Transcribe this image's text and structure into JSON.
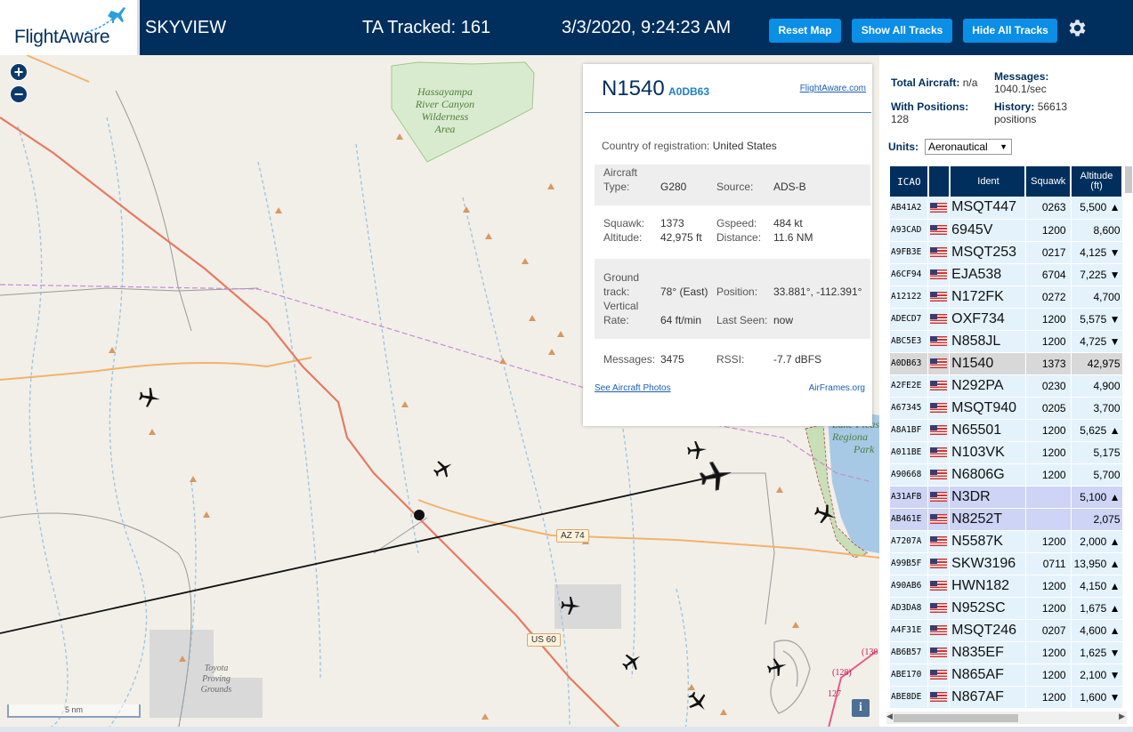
{
  "header": {
    "logo_text": "FlightAware",
    "app_title": "SKYVIEW",
    "tracked": "TA Tracked: 161",
    "clock": "3/3/2020, 9:24:23 AM",
    "buttons": {
      "reset_map": "Reset Map",
      "show_all": "Show All Tracks",
      "hide_all": "Hide All Tracks"
    },
    "settings_icon": "gear-icon",
    "colors": {
      "bar": "#002f5d",
      "button": "#0a8ee6"
    }
  },
  "map": {
    "zoom_in": "+",
    "zoom_out": "−",
    "labels": {
      "wilderness": "Hassayampa River Canyon Wilderness Area",
      "wilderness_l1": "Hassayampa",
      "wilderness_l2": "River Canyon",
      "wilderness_l3": "Wilderness",
      "wilderness_l4": "Area",
      "park_l1": "Lake Pleas",
      "park_l2": "Regiona",
      "park_l3": "Park",
      "proving_l1": "Toyota",
      "proving_l2": "Proving",
      "proving_l3": "Grounds",
      "az74": "AZ 74",
      "us60": "US 60",
      "r128": "(128)",
      "r127": "127",
      "r130": "(130"
    },
    "scale": "5 nm",
    "info": "i"
  },
  "popup": {
    "ident": "N1540",
    "hex": "A0DB63",
    "fa_link": "FlightAware.com",
    "country_label": "Country of registration:",
    "country": "United States",
    "aircraft_type_label_1": "Aircraft",
    "aircraft_type_label_2": "Type:",
    "aircraft_type": "G280",
    "source_label": "Source:",
    "source": "ADS-B",
    "squawk_label": "Squawk:",
    "squawk": "1373",
    "gspeed_label": "Gspeed:",
    "gspeed": "484 kt",
    "altitude_label": "Altitude:",
    "altitude": "42,975 ft",
    "distance_label": "Distance:",
    "distance": "11.6 NM",
    "track_label_1": "Ground",
    "track_label_2": "track:",
    "track": "78° (East)",
    "position_label": "Position:",
    "position": "33.881°, -112.391°",
    "vrate_label_1": "Vertical",
    "vrate_label_2": "Rate:",
    "vrate": "64 ft/min",
    "last_seen_label": "Last Seen:",
    "last_seen": "now",
    "messages_label": "Messages:",
    "messages": "3475",
    "rssi_label": "RSSI:",
    "rssi": "-7.7 dBFS",
    "photos_link": "See Aircraft Photos",
    "airframes_link": "AirFrames.org"
  },
  "panel": {
    "total_label": "Total Aircraft:",
    "total": "n/a",
    "messages_label": "Messages:",
    "messages": "1040.1/sec",
    "with_pos_label": "With Positions:",
    "with_pos": "128",
    "history_label": "History:",
    "history": "56613",
    "history_unit": "positions",
    "units_label": "Units:",
    "units_value": "Aeronautical",
    "columns": {
      "icao": "ICAO",
      "ident": "Ident",
      "squawk": "Squawk",
      "alt_1": "Altitude",
      "alt_2": "(ft)"
    },
    "rows": [
      {
        "icao": "AB41A2",
        "ident": "MSQT447",
        "squawk": "0263",
        "alt": "5,500 ▲"
      },
      {
        "icao": "A93CAD",
        "ident": "6945V",
        "squawk": "1200",
        "alt": "8,600"
      },
      {
        "icao": "A9FB3E",
        "ident": "MSQT253",
        "squawk": "0217",
        "alt": "4,125 ▼"
      },
      {
        "icao": "A6CF94",
        "ident": "EJA538",
        "squawk": "6704",
        "alt": "7,225 ▼"
      },
      {
        "icao": "A12122",
        "ident": "N172FK",
        "squawk": "0272",
        "alt": "4,700"
      },
      {
        "icao": "ADECD7",
        "ident": "OXF734",
        "squawk": "1200",
        "alt": "5,575 ▼"
      },
      {
        "icao": "ABC5E3",
        "ident": "N858JL",
        "squawk": "1200",
        "alt": "4,725 ▼"
      },
      {
        "icao": "A0DB63",
        "ident": "N1540",
        "squawk": "1373",
        "alt": "42,975"
      },
      {
        "icao": "A2FE2E",
        "ident": "N292PA",
        "squawk": "0230",
        "alt": "4,900"
      },
      {
        "icao": "A67345",
        "ident": "MSQT940",
        "squawk": "0205",
        "alt": "3,700"
      },
      {
        "icao": "A8A1BF",
        "ident": "N65501",
        "squawk": "1200",
        "alt": "5,625 ▲"
      },
      {
        "icao": "A011BE",
        "ident": "N103VK",
        "squawk": "1200",
        "alt": "5,175"
      },
      {
        "icao": "A90668",
        "ident": "N6806G",
        "squawk": "1200",
        "alt": "5,700"
      },
      {
        "icao": "A31AFB",
        "ident": "N3DR",
        "squawk": "",
        "alt": "5,100 ▲"
      },
      {
        "icao": "AB461E",
        "ident": "N8252T",
        "squawk": "",
        "alt": "2,075"
      },
      {
        "icao": "A7207A",
        "ident": "N5587K",
        "squawk": "1200",
        "alt": "2,000 ▲"
      },
      {
        "icao": "A99B5F",
        "ident": "SKW3196",
        "squawk": "0711",
        "alt": "13,950 ▲"
      },
      {
        "icao": "A90AB6",
        "ident": "HWN182",
        "squawk": "1200",
        "alt": "4,150 ▲"
      },
      {
        "icao": "AD3DA8",
        "ident": "N952SC",
        "squawk": "1200",
        "alt": "1,675 ▲"
      },
      {
        "icao": "A4F31E",
        "ident": "MSQT246",
        "squawk": "0207",
        "alt": "4,600 ▲"
      },
      {
        "icao": "AB6B57",
        "ident": "N835EF",
        "squawk": "1200",
        "alt": "1,625 ▼"
      },
      {
        "icao": "ABE170",
        "ident": "N865AF",
        "squawk": "1200",
        "alt": "2,100 ▼"
      },
      {
        "icao": "ABE8DE",
        "ident": "N867AF",
        "squawk": "1200",
        "alt": "1,600 ▼"
      }
    ],
    "selected_icao": "A0DB63",
    "no_squawk_highlight_color": "#cdd4f5",
    "row_color": "#e4f2fb"
  }
}
